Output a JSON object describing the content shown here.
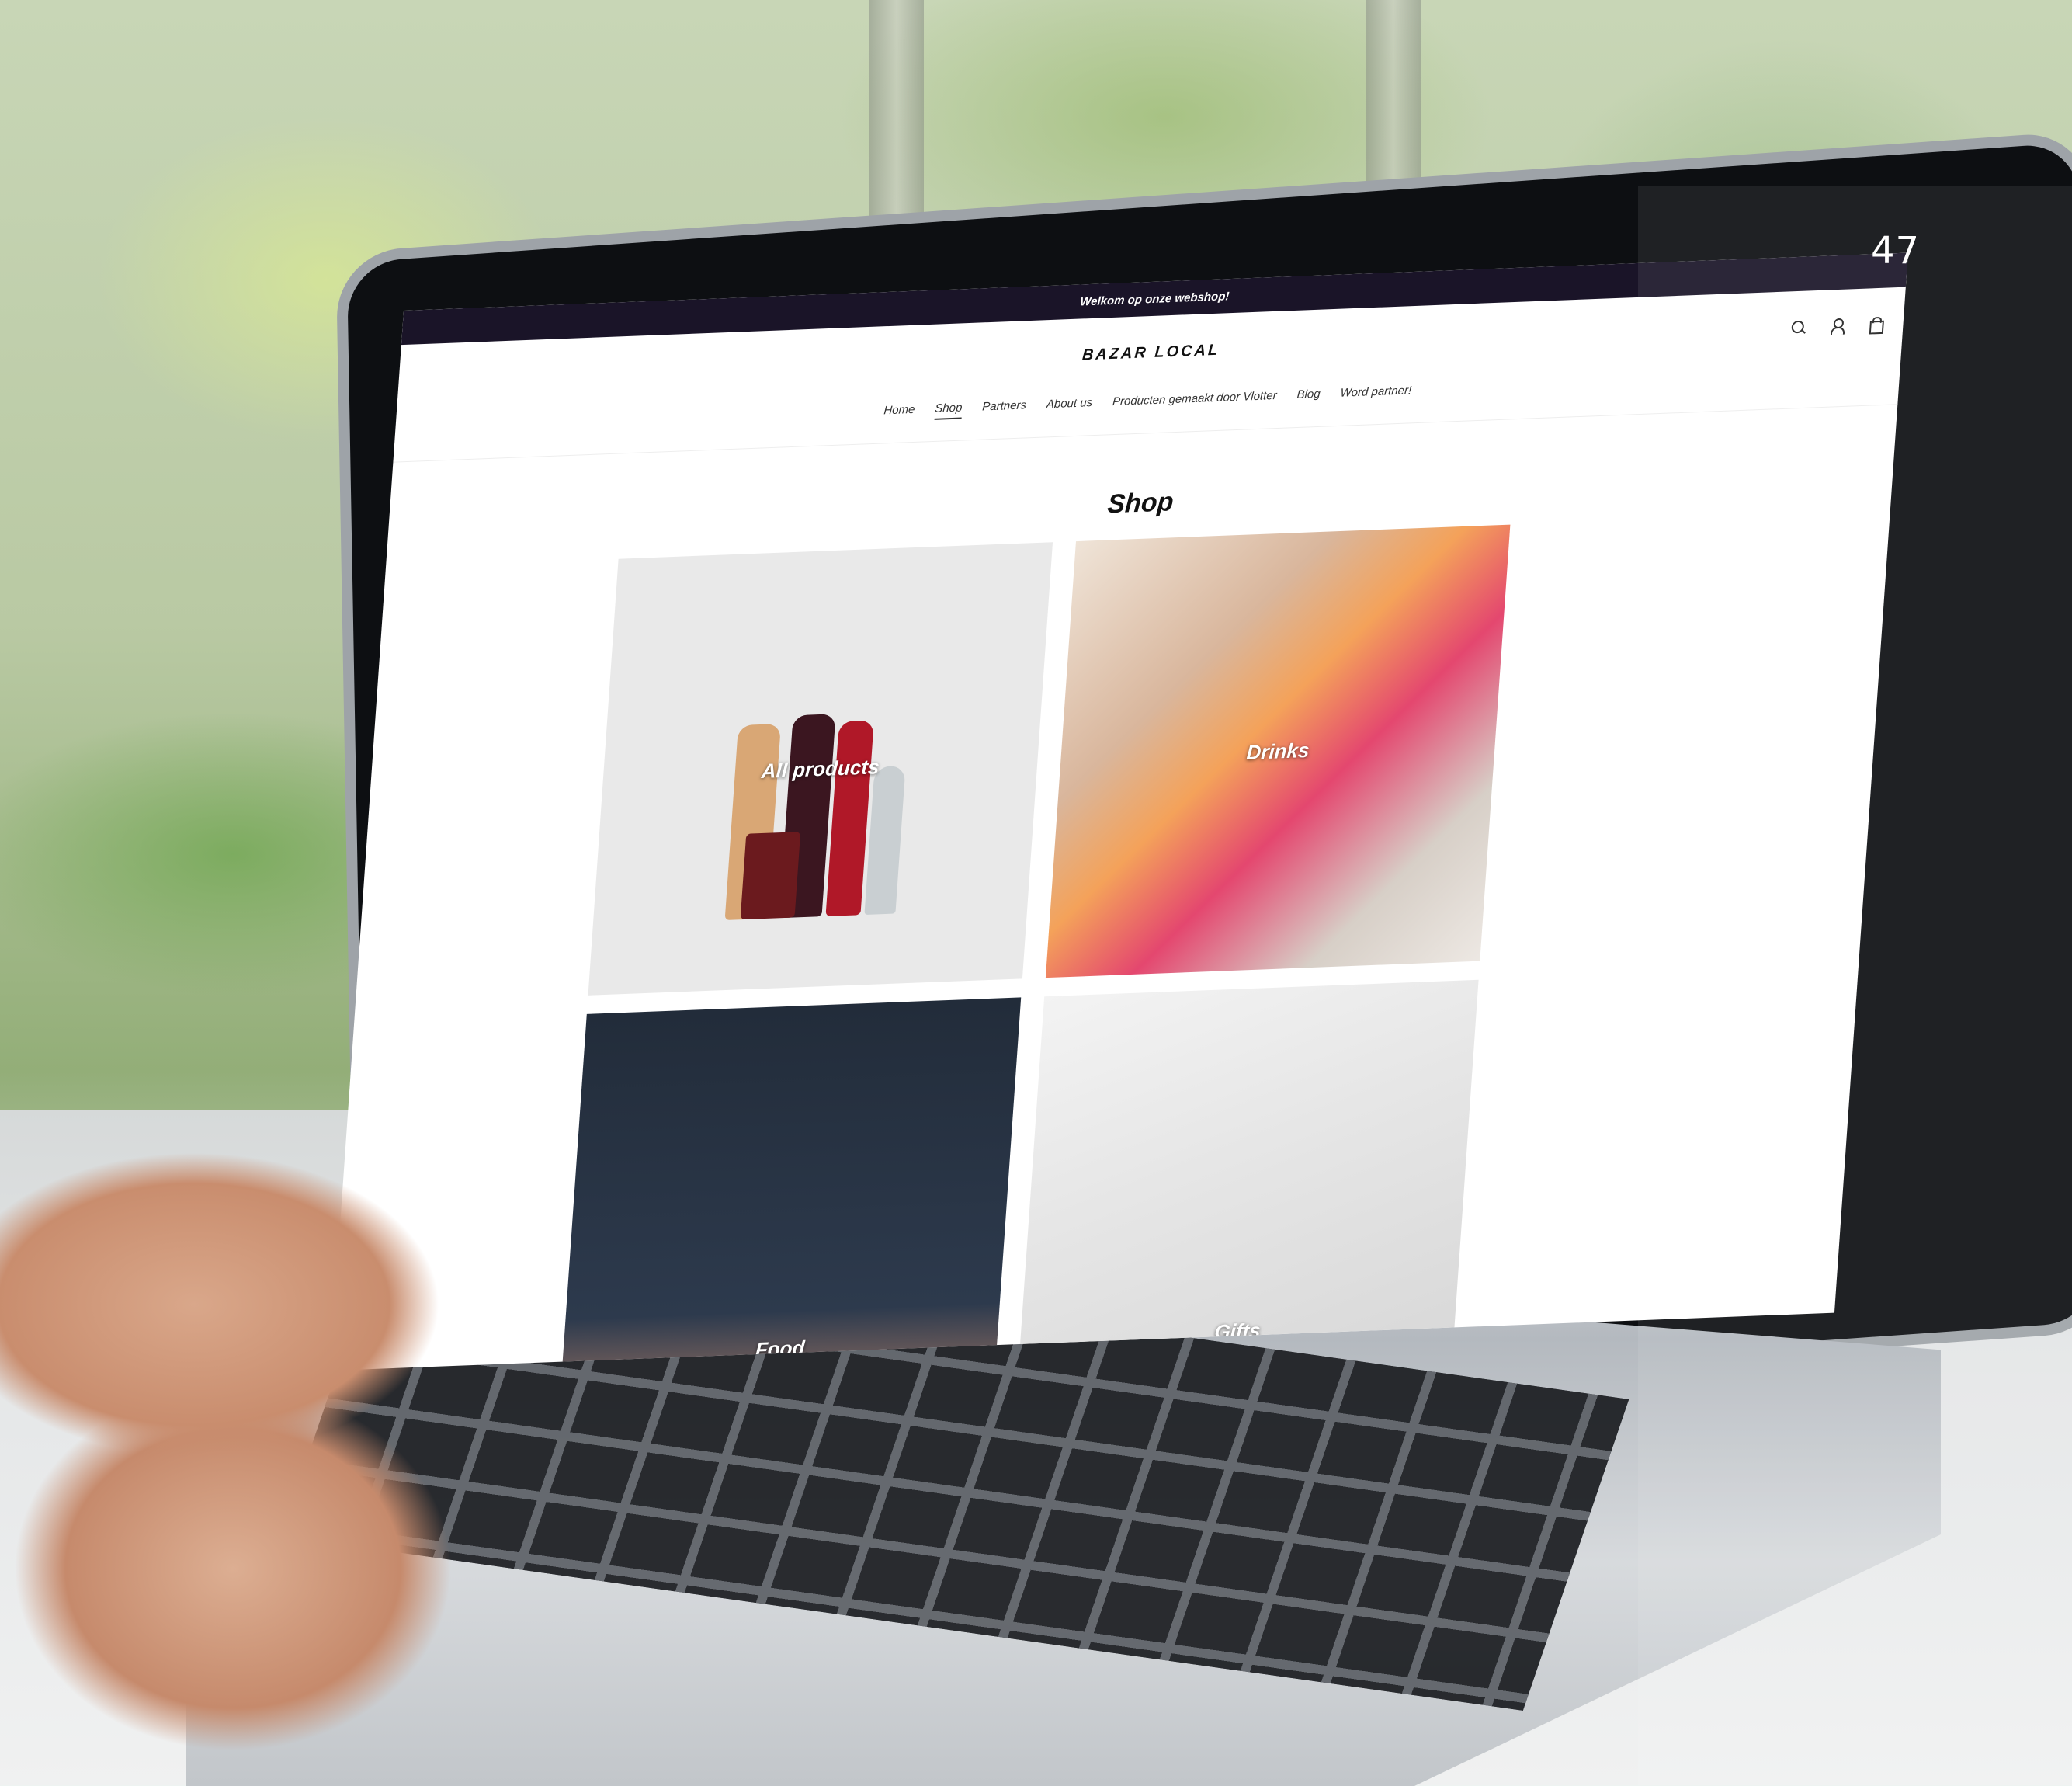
{
  "page_number": "47",
  "site": {
    "announcement": "Welkom op onze webshop!",
    "logo": "BAZAR LOCAL",
    "nav": [
      {
        "label": "Home"
      },
      {
        "label": "Shop"
      },
      {
        "label": "Partners"
      },
      {
        "label": "About us"
      },
      {
        "label": "Producten gemaakt door Vlotter"
      },
      {
        "label": "Blog"
      },
      {
        "label": "Word partner!"
      }
    ],
    "active_nav": "Shop",
    "icons": [
      "search-icon",
      "account-icon",
      "cart-icon"
    ],
    "page_title": "Shop",
    "collections": [
      {
        "label": "All products"
      },
      {
        "label": "Drinks"
      },
      {
        "label": "Food"
      },
      {
        "label": "Gifts"
      }
    ]
  },
  "colors": {
    "announcement_bar": "#1a1428",
    "page_background": "#ffffff",
    "text": "#111111"
  }
}
